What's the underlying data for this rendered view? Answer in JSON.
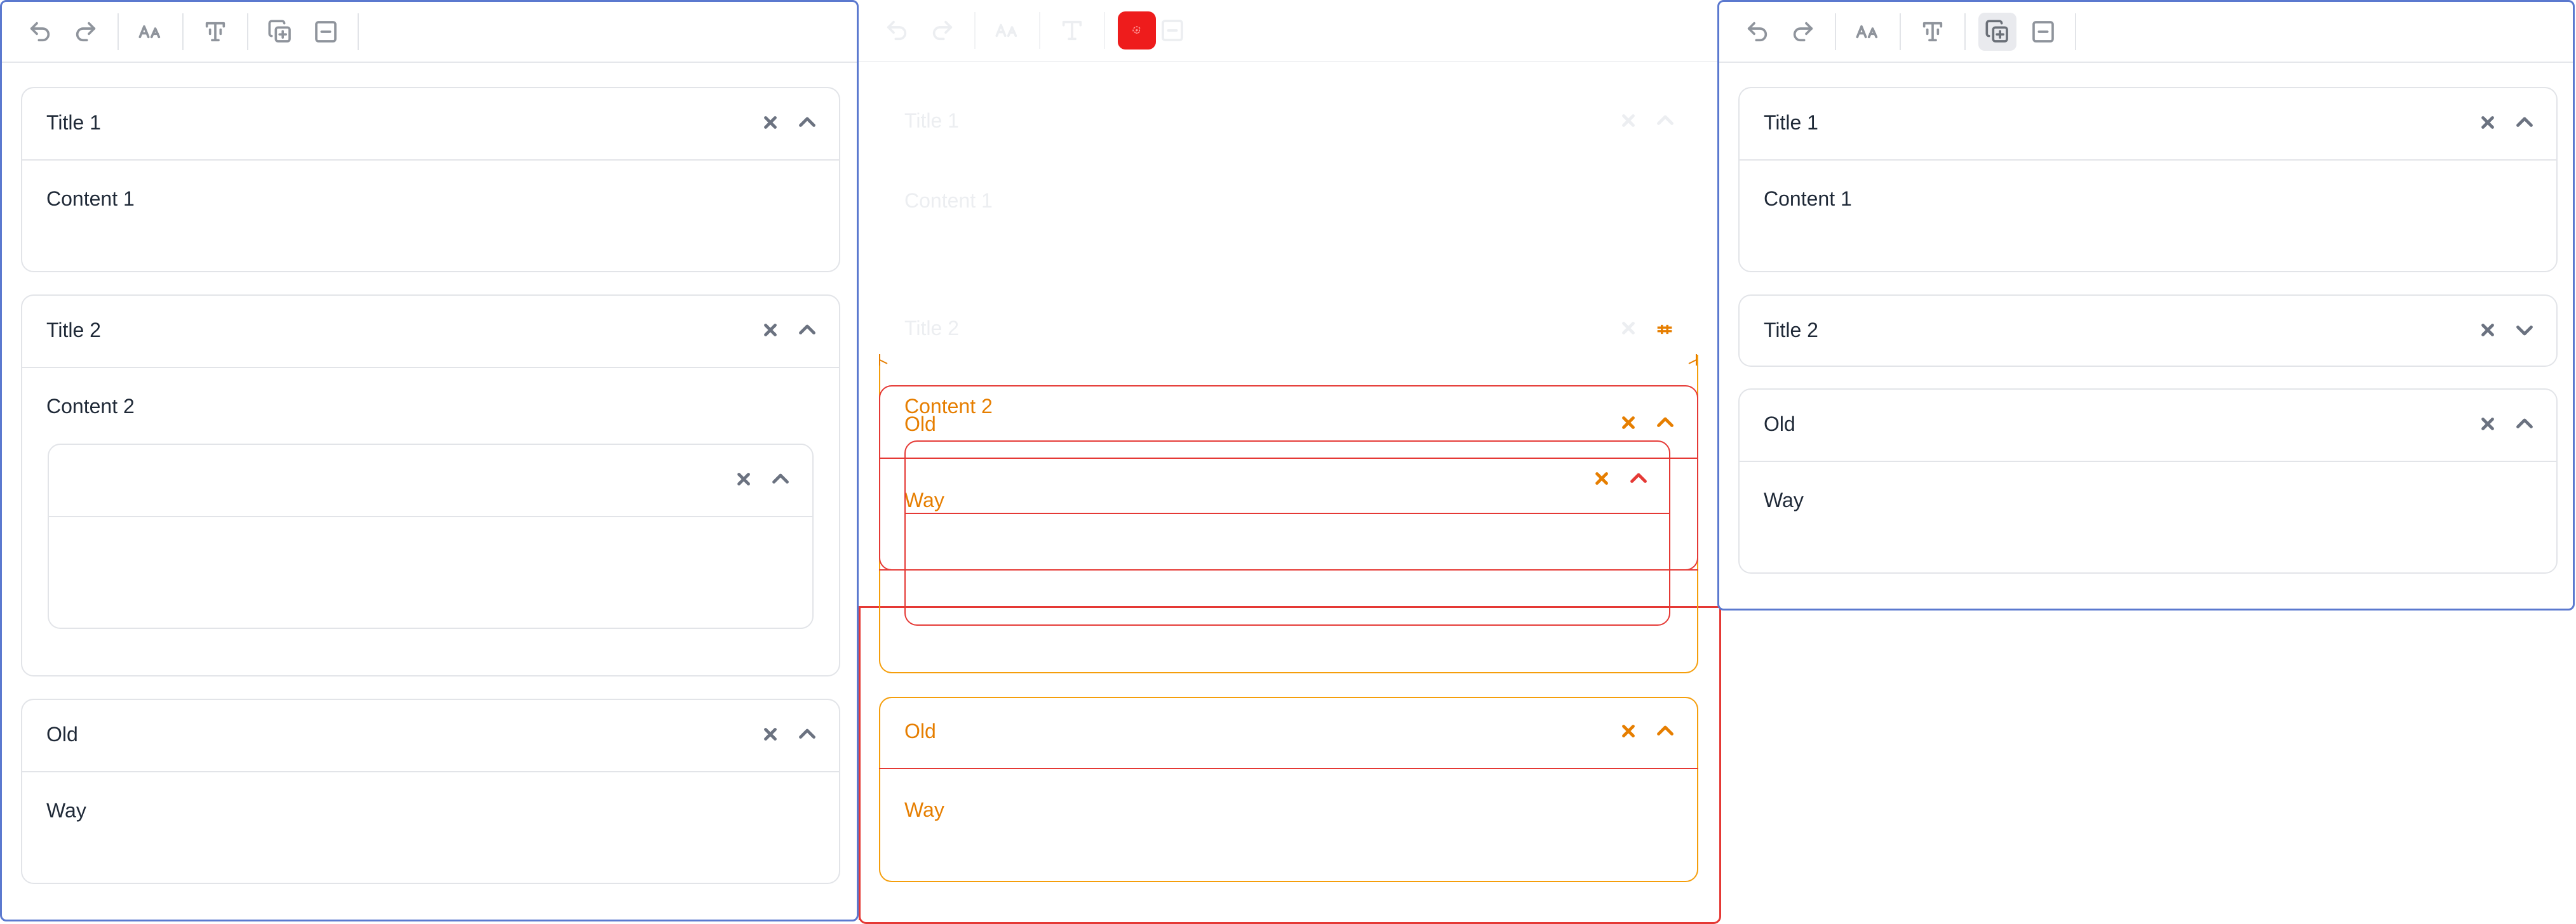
{
  "left_editor": {
    "sections": [
      {
        "title": "Title 1",
        "content": "Content 1"
      },
      {
        "title": "Title 2",
        "content": "Content 2",
        "nested": {
          "title": "",
          "content": ""
        }
      },
      {
        "title": "Old",
        "content": "Way"
      }
    ]
  },
  "middle_overlay": {
    "ghost_sections": [
      {
        "title": "Title 1",
        "content": "Content 1"
      },
      {
        "title": "Title 2"
      }
    ],
    "dragged_content": "Content 2",
    "dragged_title": "Old",
    "dragged_body": "Way",
    "bottom_section": {
      "title": "Old",
      "content": "Way"
    }
  },
  "right_editor": {
    "sections": [
      {
        "title": "Title 1",
        "content": "Content 1",
        "state": "expanded"
      },
      {
        "title": "Title 2",
        "state": "collapsed"
      },
      {
        "title": "Old",
        "content": "Way",
        "state": "expanded"
      }
    ]
  },
  "colors": {
    "editor_border": "#5b79cf",
    "overlay_border": "#e53935",
    "overlay_text": "#e67e00",
    "section_border": "#e2e4e8"
  }
}
